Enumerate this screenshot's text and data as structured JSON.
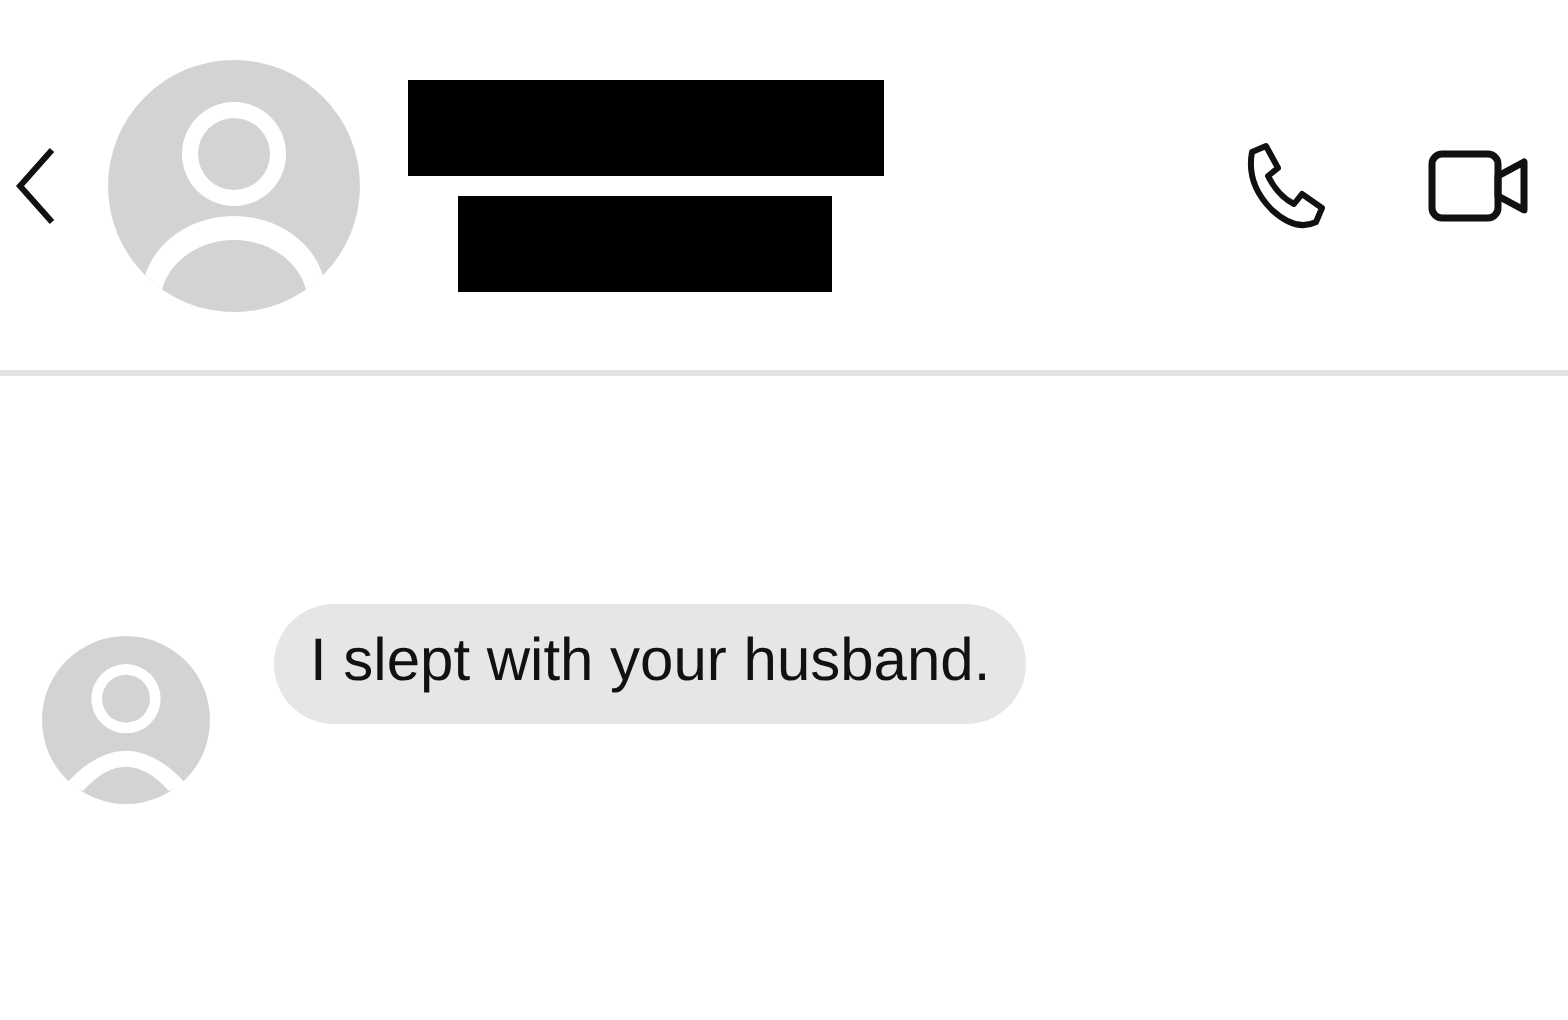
{
  "header": {
    "name_lines": [
      {
        "kind": "redacted"
      },
      {
        "kind": "redacted"
      }
    ]
  },
  "messages": [
    {
      "text": "I slept with your husband."
    }
  ]
}
